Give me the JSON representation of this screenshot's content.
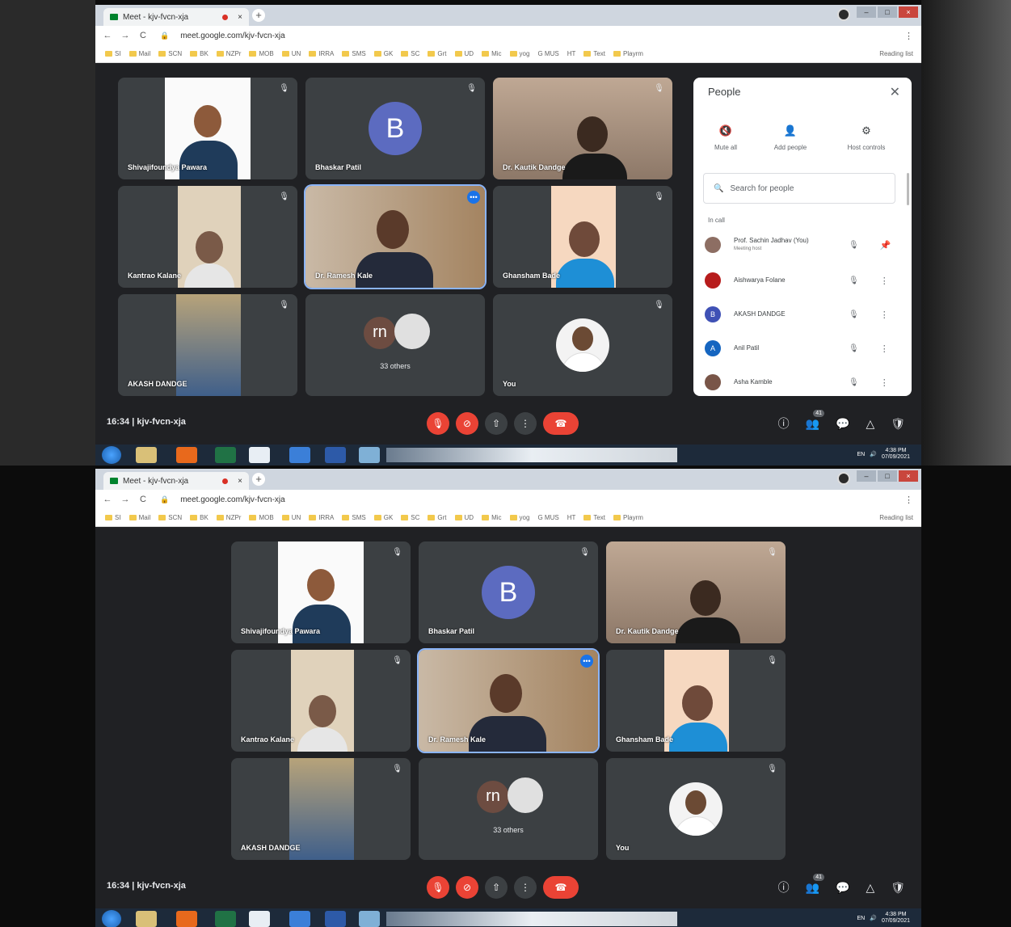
{
  "browser": {
    "tab_title": "Meet - kjv-fvcn-xja",
    "tab_close": "×",
    "new_tab": "+",
    "url": "meet.google.com/kjv-fvcn-xja",
    "lock": "🔒",
    "back": "←",
    "forward": "→",
    "reload": "C",
    "window_buttons": [
      "–",
      "□",
      "×"
    ],
    "extensions": [
      "⋮"
    ],
    "bookmarks": [
      "SI",
      "Mail",
      "SCN",
      "BK",
      "NZPr",
      "MOB",
      "UN",
      "IRRA",
      "SMS",
      "GK",
      "SC",
      "Grt",
      "UD",
      "Mic",
      "yog",
      "G MUS",
      "HT",
      "Text",
      "Playrm"
    ],
    "reading_list": "Reading list"
  },
  "meeting": {
    "time": "16:34",
    "separator": "|",
    "code": "kjv-fvcn-xja",
    "people_count": "41",
    "tiles": [
      {
        "name": "Shivajifoundya Pawara",
        "kind": "video"
      },
      {
        "name": "Bhaskar Patil",
        "kind": "avatar",
        "initial": "B"
      },
      {
        "name": "Dr. Kautik Dandge",
        "kind": "video"
      },
      {
        "name": "Kantrao Kalane",
        "kind": "video"
      },
      {
        "name": "Dr. Ramesh Kale",
        "kind": "video",
        "speaking": true
      },
      {
        "name": "Ghansham Bade",
        "kind": "video"
      },
      {
        "name": "AKASH DANDGE",
        "kind": "video"
      },
      {
        "name": "33 others",
        "kind": "others",
        "initial": "rn"
      },
      {
        "name": "You",
        "kind": "you"
      }
    ],
    "controls": {
      "mic": "🎙",
      "cam": "⊘",
      "present": "⇧",
      "more": "⋮",
      "end": "☎",
      "info": "ⓘ",
      "people": "👥",
      "chat": "💬",
      "activities": "△",
      "safety": "🛡"
    }
  },
  "people_panel": {
    "title": "People",
    "close": "✕",
    "actions": [
      {
        "label": "Mute all",
        "icon": "🔇"
      },
      {
        "label": "Add people",
        "icon": "👤"
      },
      {
        "label": "Host controls",
        "icon": "⚙"
      }
    ],
    "search_placeholder": "Search for people",
    "section": "In call",
    "participants": [
      {
        "name": "Prof. Sachin Jadhav (You)",
        "sub": "Meeting host",
        "initial": "",
        "color": "#8d6e63"
      },
      {
        "name": "Aishwarya Folane",
        "sub": "",
        "initial": "",
        "color": "#b71c1c"
      },
      {
        "name": "AKASH DANDGE",
        "sub": "",
        "initial": "B",
        "color": "#3f51b5"
      },
      {
        "name": "Anil Patil",
        "sub": "",
        "initial": "A",
        "color": "#1565c0"
      },
      {
        "name": "Asha Kamble",
        "sub": "",
        "initial": "",
        "color": "#795548"
      }
    ]
  },
  "taskbar": {
    "lang": "EN",
    "time": "4:38 PM",
    "date": "07/09/2021"
  }
}
